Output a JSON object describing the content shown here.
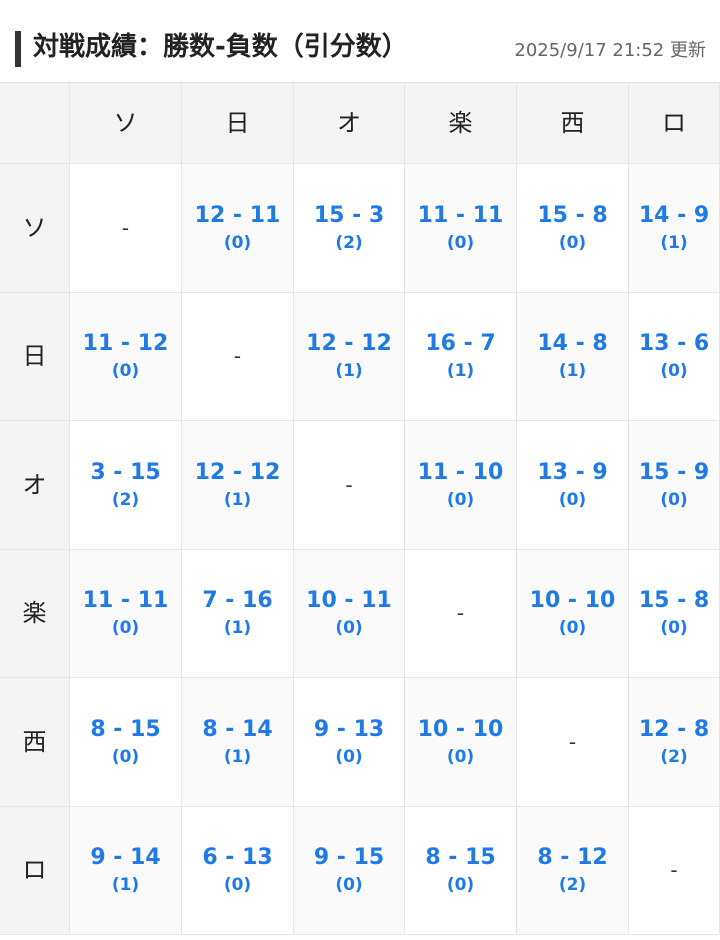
{
  "header": {
    "title": "対戦成績：勝数-負数（引分数）",
    "updated": "2025/9/17 21:52 更新"
  },
  "teams": [
    "ソ",
    "日",
    "オ",
    "楽",
    "西",
    "ロ"
  ],
  "rows": [
    {
      "team": "ソ",
      "cells": [
        {
          "score": "-",
          "draws": ""
        },
        {
          "score": "12 - 11",
          "draws": "(0)"
        },
        {
          "score": "15 - 3",
          "draws": "(2)"
        },
        {
          "score": "11 - 11",
          "draws": "(0)"
        },
        {
          "score": "15 - 8",
          "draws": "(0)"
        },
        {
          "score": "14 - 9",
          "draws": "(1)"
        }
      ]
    },
    {
      "team": "日",
      "cells": [
        {
          "score": "11 - 12",
          "draws": "(0)"
        },
        {
          "score": "-",
          "draws": ""
        },
        {
          "score": "12 - 12",
          "draws": "(1)"
        },
        {
          "score": "16 - 7",
          "draws": "(1)"
        },
        {
          "score": "14 - 8",
          "draws": "(1)"
        },
        {
          "score": "13 - 6",
          "draws": "(0)"
        }
      ]
    },
    {
      "team": "オ",
      "cells": [
        {
          "score": "3 - 15",
          "draws": "(2)"
        },
        {
          "score": "12 - 12",
          "draws": "(1)"
        },
        {
          "score": "-",
          "draws": ""
        },
        {
          "score": "11 - 10",
          "draws": "(0)"
        },
        {
          "score": "13 - 9",
          "draws": "(0)"
        },
        {
          "score": "15 - 9",
          "draws": "(0)"
        }
      ]
    },
    {
      "team": "楽",
      "cells": [
        {
          "score": "11 - 11",
          "draws": "(0)"
        },
        {
          "score": "7 - 16",
          "draws": "(1)"
        },
        {
          "score": "10 - 11",
          "draws": "(0)"
        },
        {
          "score": "-",
          "draws": ""
        },
        {
          "score": "10 - 10",
          "draws": "(0)"
        },
        {
          "score": "15 - 8",
          "draws": "(0)"
        }
      ]
    },
    {
      "team": "西",
      "cells": [
        {
          "score": "8 - 15",
          "draws": "(0)"
        },
        {
          "score": "8 - 14",
          "draws": "(1)"
        },
        {
          "score": "9 - 13",
          "draws": "(0)"
        },
        {
          "score": "10 - 10",
          "draws": "(0)"
        },
        {
          "score": "-",
          "draws": ""
        },
        {
          "score": "12 - 8",
          "draws": "(2)"
        }
      ]
    },
    {
      "team": "ロ",
      "cells": [
        {
          "score": "9 - 14",
          "draws": "(1)"
        },
        {
          "score": "6 - 13",
          "draws": "(0)"
        },
        {
          "score": "9 - 15",
          "draws": "(0)"
        },
        {
          "score": "8 - 15",
          "draws": "(0)"
        },
        {
          "score": "8 - 12",
          "draws": "(2)"
        },
        {
          "score": "-",
          "draws": ""
        }
      ]
    }
  ],
  "colors": {
    "score": "#1f7ae6",
    "header_bg": "#f4f4f4",
    "alt_bg": "#fafafa",
    "title_bar": "#333333"
  }
}
